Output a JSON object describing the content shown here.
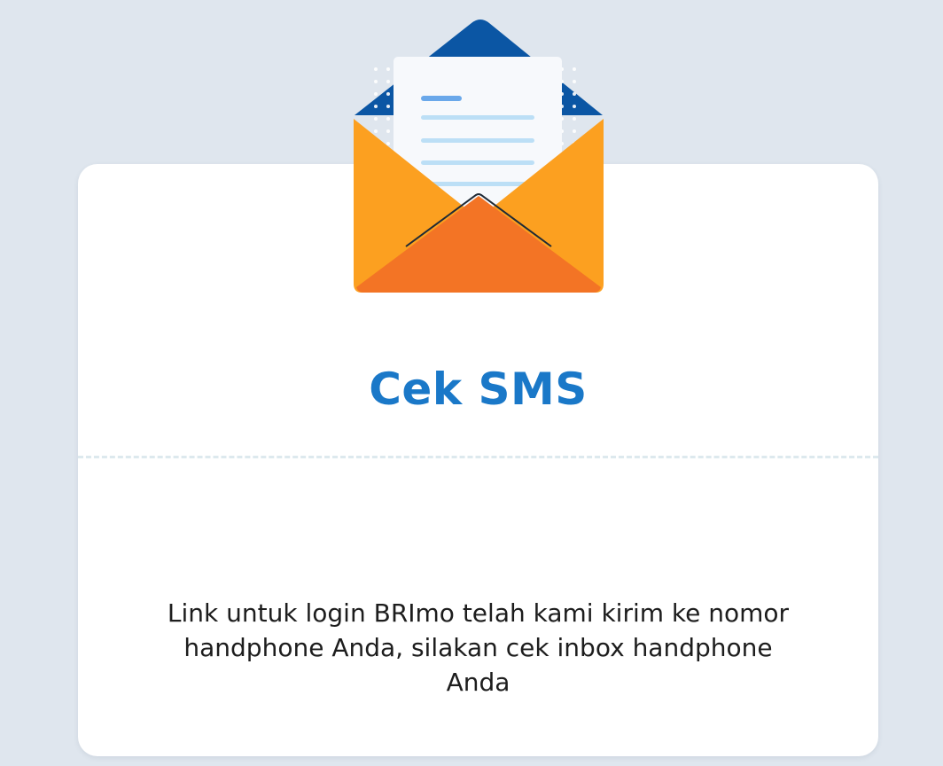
{
  "dialog": {
    "icon": "envelope-letter-icon",
    "title": "Cek SMS",
    "message": "Link untuk login BRImo telah kami kirim ke nomor handphone Anda, silakan cek inbox handphone Anda"
  },
  "colors": {
    "background": "#dfe6ee",
    "card": "#ffffff",
    "title": "#1a78c8",
    "envelope_body": "#fca020",
    "envelope_front": "#f37425",
    "envelope_back": "#0b56a4",
    "letter": "#f7f9fc",
    "letter_lines": "#bcdff6"
  }
}
